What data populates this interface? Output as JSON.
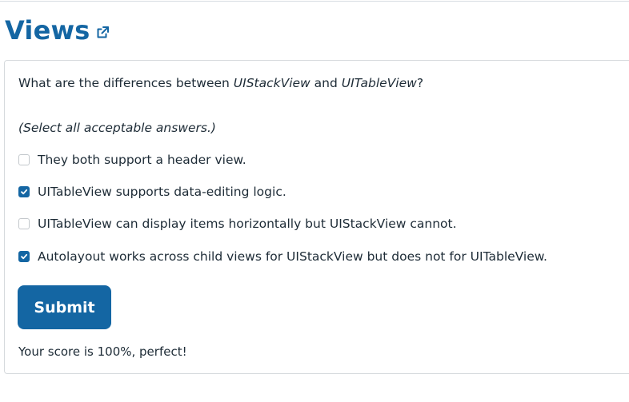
{
  "header": {
    "title": "Views",
    "link_icon": "external-link-icon",
    "accent_color": "#1466a3"
  },
  "quiz": {
    "question": {
      "prefix": "What are the differences between ",
      "term1": "UIStackView",
      "middle": " and ",
      "term2": "UITableView",
      "suffix": "?"
    },
    "instructions": "(Select all acceptable answers.)",
    "options": [
      {
        "label": "They both support a header view.",
        "checked": false
      },
      {
        "label": "UITableView supports data-editing logic.",
        "checked": true
      },
      {
        "label": "UITableView can display items horizontally but UIStackView cannot.",
        "checked": false
      },
      {
        "label": "Autolayout works across child views for UIStackView but does not for UITableView.",
        "checked": true
      }
    ],
    "submit_label": "Submit",
    "score_text": "Your score is 100%, perfect!"
  }
}
